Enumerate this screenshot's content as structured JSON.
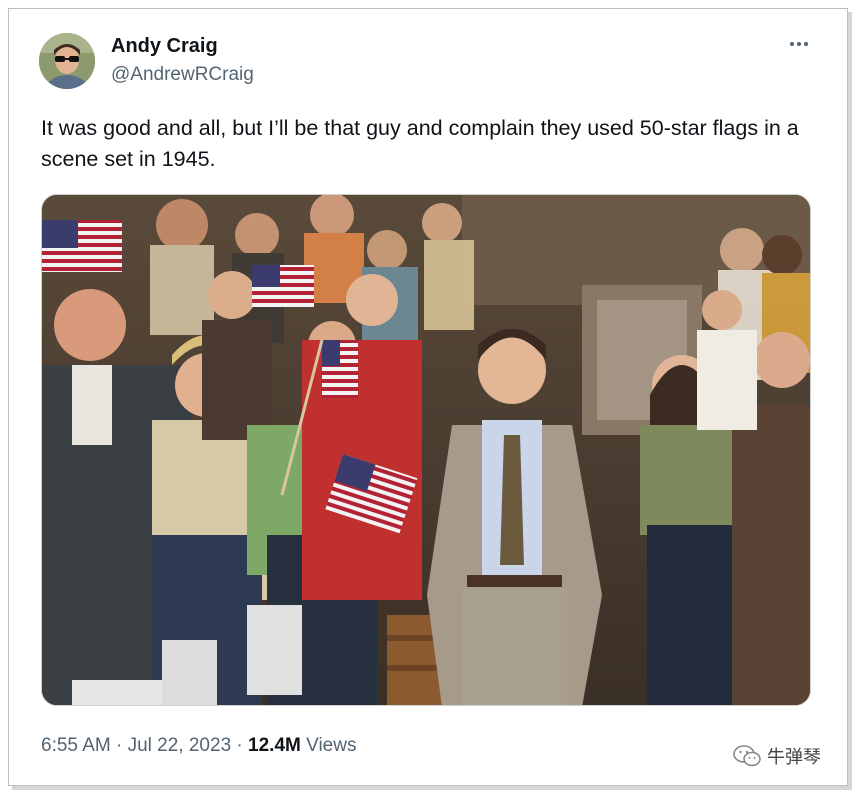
{
  "tweet": {
    "author_name": "Andy Craig",
    "author_handle": "@AndrewRCraig",
    "text": "It was good and all, but I’ll be that guy and complain they used 50-star flags in a scene set in 1945.",
    "time": "6:55 AM",
    "separator": "·",
    "date": "Jul 22, 2023",
    "views_count": "12.4M",
    "views_label": "Views",
    "more_icon": "more-horizontal-icon"
  },
  "watermark": {
    "label": "牛弹琴",
    "icon": "wechat-icon"
  },
  "colors": {
    "text_primary": "#0f1419",
    "text_secondary": "#536471",
    "border": "#bfbfbf"
  }
}
